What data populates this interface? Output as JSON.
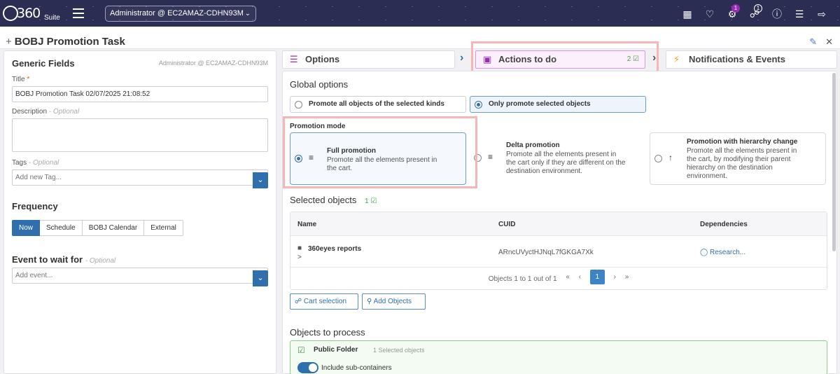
{
  "app": {
    "logo_text": "360",
    "logo_sub": "Suite",
    "environment": "Administrator @ EC2AMAZ-CDHN93M",
    "notification_count": "1",
    "cart_count": "1"
  },
  "page": {
    "title": "BOBJ Promotion Task"
  },
  "generic_fields": {
    "heading": "Generic Fields",
    "user": "Administrator @ EC2AMAZ-CDHN93M",
    "title_label": "Title",
    "title_required": "*",
    "title_value": "BOBJ Promotion Task 02/07/2025 21:08:52",
    "description_label": "Description",
    "optional": "- Optional",
    "tags_label": "Tags",
    "tags_placeholder": "Add new Tag..."
  },
  "frequency": {
    "heading": "Frequency",
    "options": [
      "Now",
      "Schedule",
      "BOBJ Calendar",
      "External"
    ]
  },
  "event": {
    "heading": "Event to wait for",
    "optional": "- Optional",
    "placeholder": "Add event..."
  },
  "tabs": {
    "options": "Options",
    "actions": "Actions to do",
    "actions_count": "2",
    "notifications": "Notifications & Events"
  },
  "global_options": {
    "heading": "Global options",
    "all_kinds": "Promote all objects of the selected kinds",
    "selected_only": "Only promote selected objects"
  },
  "promotion_mode": {
    "label": "Promotion mode",
    "full_title": "Full promotion",
    "full_desc_1": "Promote all the elements present in",
    "full_desc_2": "the cart.",
    "delta_title": "Delta promotion",
    "delta_desc_1": "Promote all the elements present in",
    "delta_desc_2": "the cart only if they are different on the",
    "delta_desc_3": "destination environment.",
    "hier_title": "Promotion with hierarchy change",
    "hier_desc_1": "Promote all the elements present in",
    "hier_desc_2": "the cart, by modifying their parent",
    "hier_desc_3": "hierarchy on the destination",
    "hier_desc_4": "environment."
  },
  "selected_objects": {
    "heading": "Selected objects",
    "count": "1",
    "col_name": "Name",
    "col_cuid": "CUID",
    "col_deps": "Dependencies",
    "row_name": "360eyes reports",
    "row_expand": ">",
    "row_cuid": "ARncUVyctHJNqL7fGKGA7Xk",
    "row_deps": "Research...",
    "pager_text": "Objects 1 to 1 out of 1",
    "page": "1",
    "first": "«",
    "prev": "‹",
    "next": "›",
    "last": "»"
  },
  "buttons": {
    "cart_selection": "Cart selection",
    "add_objects": "Add Objects"
  },
  "objects_to_process": {
    "heading": "Objects to process",
    "folder": "Public Folder",
    "selected": "1 Selected objects",
    "include_sub": "Include sub-containers"
  }
}
